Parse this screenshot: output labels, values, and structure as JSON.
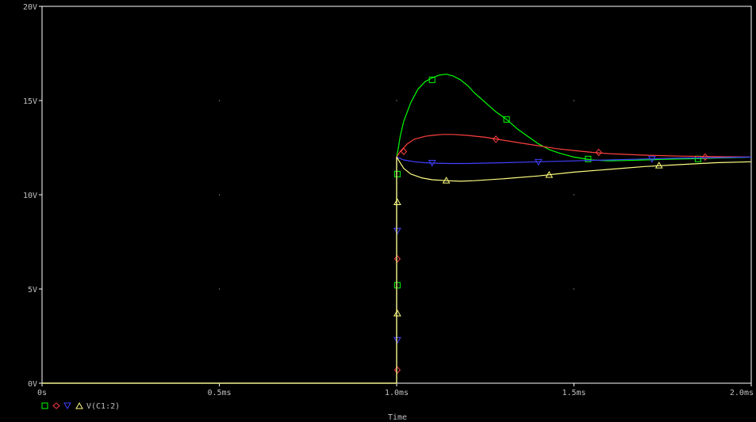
{
  "chart_data": {
    "type": "line",
    "xlabel": "Time",
    "xlim": [
      0,
      2.0
    ],
    "ylim": [
      0,
      20
    ],
    "x_unit": "ms",
    "y_unit": "V",
    "grid": "dots",
    "x_ticks": [
      {
        "value": 0,
        "label": "0s"
      },
      {
        "value": 0.5,
        "label": "0.5ms"
      },
      {
        "value": 1.0,
        "label": "1.0ms"
      },
      {
        "value": 1.5,
        "label": "1.5ms"
      },
      {
        "value": 2.0,
        "label": "2.0ms"
      }
    ],
    "y_ticks": [
      {
        "value": 0,
        "label": "0V"
      },
      {
        "value": 5,
        "label": "5V"
      },
      {
        "value": 10,
        "label": "10V"
      },
      {
        "value": 15,
        "label": "15V"
      },
      {
        "value": 20,
        "label": "20V"
      }
    ],
    "legend_label": "V(C1:2)",
    "legend_position": "bottom-left",
    "series": [
      {
        "color": "#00ff00",
        "marker": "square",
        "x": [
          0,
          1.0,
          1.0,
          1.005,
          1.01,
          1.02,
          1.04,
          1.06,
          1.08,
          1.1,
          1.12,
          1.14,
          1.16,
          1.18,
          1.2,
          1.22,
          1.25,
          1.28,
          1.31,
          1.34,
          1.37,
          1.4,
          1.43,
          1.46,
          1.5,
          1.55,
          1.6,
          1.65,
          1.7,
          1.75,
          1.8,
          1.85,
          1.9,
          1.95,
          2.0
        ],
        "y": [
          0,
          0,
          12.0,
          12.5,
          13.1,
          13.9,
          14.9,
          15.6,
          16.0,
          16.2,
          16.35,
          16.4,
          16.3,
          16.1,
          15.8,
          15.4,
          14.9,
          14.4,
          14.0,
          13.5,
          13.1,
          12.7,
          12.4,
          12.2,
          12.0,
          11.85,
          11.8,
          11.82,
          11.85,
          11.88,
          11.9,
          11.92,
          11.95,
          11.97,
          12.0
        ],
        "markers": [
          [
            1.002,
            5.2
          ],
          [
            1.002,
            11.1
          ],
          [
            1.1,
            16.1
          ],
          [
            1.31,
            14.0
          ],
          [
            1.54,
            11.9
          ],
          [
            1.85,
            11.9
          ]
        ]
      },
      {
        "color": "#ff4040",
        "marker": "diamond",
        "x": [
          0,
          1.0,
          1.0,
          1.01,
          1.03,
          1.05,
          1.08,
          1.1,
          1.13,
          1.16,
          1.2,
          1.25,
          1.3,
          1.35,
          1.4,
          1.45,
          1.5,
          1.55,
          1.6,
          1.7,
          1.8,
          1.9,
          2.0
        ],
        "y": [
          0,
          0,
          12.0,
          12.3,
          12.7,
          12.95,
          13.1,
          13.15,
          13.2,
          13.2,
          13.15,
          13.05,
          12.9,
          12.75,
          12.6,
          12.45,
          12.35,
          12.25,
          12.18,
          12.1,
          12.05,
          12.02,
          12.0
        ],
        "markers": [
          [
            1.002,
            0.7
          ],
          [
            1.002,
            6.6
          ],
          [
            1.02,
            12.3
          ],
          [
            1.28,
            12.95
          ],
          [
            1.57,
            12.25
          ],
          [
            1.87,
            12.0
          ]
        ]
      },
      {
        "color": "#4040ff",
        "marker": "triangle-down",
        "x": [
          0,
          1.0,
          1.0,
          1.02,
          1.05,
          1.08,
          1.1,
          1.15,
          1.2,
          1.3,
          1.4,
          1.5,
          1.6,
          1.7,
          1.8,
          1.9,
          2.0
        ],
        "y": [
          0,
          0,
          12.0,
          11.85,
          11.75,
          11.7,
          11.68,
          11.66,
          11.66,
          11.7,
          11.75,
          11.8,
          11.85,
          11.9,
          11.95,
          11.97,
          12.0
        ],
        "markers": [
          [
            1.002,
            2.3
          ],
          [
            1.002,
            8.1
          ],
          [
            1.1,
            11.7
          ],
          [
            1.4,
            11.75
          ],
          [
            1.72,
            11.9
          ]
        ]
      },
      {
        "color": "#ffff80",
        "marker": "triangle-up",
        "x": [
          0,
          1.0,
          1.0,
          1.02,
          1.04,
          1.07,
          1.1,
          1.14,
          1.18,
          1.22,
          1.3,
          1.4,
          1.5,
          1.6,
          1.7,
          1.8,
          1.9,
          2.0
        ],
        "y": [
          0,
          0,
          12.0,
          11.4,
          11.1,
          10.9,
          10.8,
          10.75,
          10.72,
          10.75,
          10.85,
          11.0,
          11.2,
          11.35,
          11.5,
          11.6,
          11.7,
          11.75
        ],
        "markers": [
          [
            1.002,
            3.7
          ],
          [
            1.002,
            9.6
          ],
          [
            1.14,
            10.75
          ],
          [
            1.43,
            11.05
          ],
          [
            1.74,
            11.55
          ]
        ]
      }
    ]
  }
}
